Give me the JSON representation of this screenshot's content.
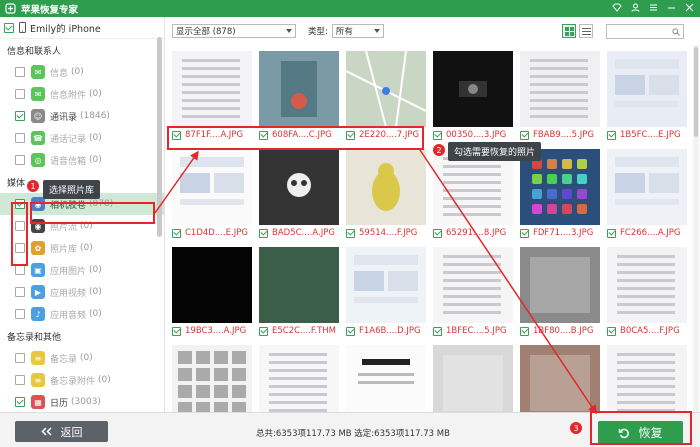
{
  "app": {
    "title": "苹果恢复专家"
  },
  "titlebar": {
    "icons": [
      "diamond-icon",
      "user-icon",
      "menu-icon",
      "minimize-icon",
      "close-icon"
    ]
  },
  "device": {
    "name": "Emily的 iPhone"
  },
  "sidebar": {
    "sections": [
      {
        "label": "信息和联系人",
        "items": [
          {
            "label": "信息",
            "count": "(0)",
            "checked": false,
            "color": "#5bc45b",
            "icon": "message-icon"
          },
          {
            "label": "信息附件",
            "count": "(0)",
            "checked": false,
            "color": "#5bc45b",
            "icon": "attachment-icon"
          },
          {
            "label": "通讯录",
            "count": "(1846)",
            "checked": true,
            "color": "#8a8a8a",
            "icon": "contacts-icon"
          },
          {
            "label": "通话记录",
            "count": "(0)",
            "checked": false,
            "color": "#5bc45b",
            "icon": "phone-icon"
          },
          {
            "label": "语音信箱",
            "count": "(0)",
            "checked": false,
            "color": "#5bc45b",
            "icon": "voicemail-icon"
          }
        ]
      },
      {
        "label": "媒体",
        "items": [
          {
            "label": "相机胶卷",
            "count": "(878)",
            "checked": true,
            "color": "#4a7ec7",
            "icon": "camera-icon",
            "selected": true
          },
          {
            "label": "照片流",
            "count": "(0)",
            "checked": false,
            "color": "#444",
            "icon": "camera-roll-icon"
          },
          {
            "label": "照片库",
            "count": "(0)",
            "checked": false,
            "color": "#e0a030",
            "icon": "photo-library-icon"
          },
          {
            "label": "应用图片",
            "count": "(0)",
            "checked": false,
            "color": "#4aa0e0",
            "icon": "app-photo-icon"
          },
          {
            "label": "应用视频",
            "count": "(0)",
            "checked": false,
            "color": "#4aa0e0",
            "icon": "app-video-icon"
          },
          {
            "label": "应用音频",
            "count": "(0)",
            "checked": false,
            "color": "#4aa0e0",
            "icon": "app-audio-icon"
          }
        ]
      },
      {
        "label": "备忘录和其他",
        "items": [
          {
            "label": "备忘录",
            "count": "(0)",
            "checked": false,
            "color": "#e8c840",
            "icon": "notes-icon"
          },
          {
            "label": "备忘录附件",
            "count": "(0)",
            "checked": false,
            "color": "#e8c840",
            "icon": "notes-attachment-icon"
          },
          {
            "label": "日历",
            "count": "(3003)",
            "checked": true,
            "color": "#e05050",
            "icon": "calendar-icon"
          }
        ]
      }
    ]
  },
  "toolbar": {
    "filter_value": "显示全部 (878)",
    "type_label": "类型:",
    "type_value": "所有"
  },
  "rows": [
    {
      "tiles": [
        {
          "name": "87F1F....A.JPG",
          "checked": true,
          "img": "settings"
        },
        {
          "name": "608FA....C.JPG",
          "checked": true,
          "img": "book"
        },
        {
          "name": "2E220....7.JPG",
          "checked": true,
          "img": "map"
        },
        {
          "name": "00350....3.JPG",
          "checked": true,
          "img": "dark"
        },
        {
          "name": "FBAB9....5.JPG",
          "checked": true,
          "img": "settings2"
        },
        {
          "name": "1B5FC....E.JPG",
          "checked": true,
          "img": "ipad"
        }
      ]
    },
    {
      "tiles": [
        {
          "name": "C1D4D....E.JPG",
          "checked": true,
          "img": "web"
        },
        {
          "name": "BAD5C....A.JPG",
          "checked": true,
          "img": "skull"
        },
        {
          "name": "59514....F.JPG",
          "checked": true,
          "img": "cartoon"
        },
        {
          "name": "65291....8.JPG",
          "checked": true,
          "img": "list"
        },
        {
          "name": "FDF71....3.JPG",
          "checked": true,
          "img": "home"
        },
        {
          "name": "FC266....A.JPG",
          "checked": true,
          "img": "chat"
        }
      ]
    },
    {
      "tiles": [
        {
          "name": "19BC3....A.JPG",
          "checked": true,
          "img": "black"
        },
        {
          "name": "E5C2C....F.THM",
          "checked": true,
          "img": "green"
        },
        {
          "name": "F1A6B....D.JPG",
          "checked": true,
          "img": "store"
        },
        {
          "name": "1BFEC....5.JPG",
          "checked": true,
          "img": "settings3"
        },
        {
          "name": "1BF80....B.JPG",
          "checked": true,
          "img": "photo"
        },
        {
          "name": "B0CA5....F.JPG",
          "checked": true,
          "img": "settings4"
        }
      ]
    },
    {
      "tiles": [
        {
          "name": "",
          "checked": false,
          "img": "grid"
        },
        {
          "name": "",
          "checked": false,
          "img": "list2"
        },
        {
          "name": "",
          "checked": false,
          "img": "appleid"
        },
        {
          "name": "",
          "checked": false,
          "img": "phone"
        },
        {
          "name": "",
          "checked": false,
          "img": "hand"
        },
        {
          "name": "",
          "checked": false,
          "img": "settings5"
        }
      ]
    }
  ],
  "annotations": {
    "tip1": "选择照片库",
    "tip2": "勾选需要恢复的照片",
    "badge1": "1",
    "badge2": "2",
    "badge3": "3"
  },
  "footer": {
    "back_label": "返回",
    "totals": "总共:6353项117.73 MB 选定:6353项117.73 MB",
    "recover_label": "恢复"
  }
}
